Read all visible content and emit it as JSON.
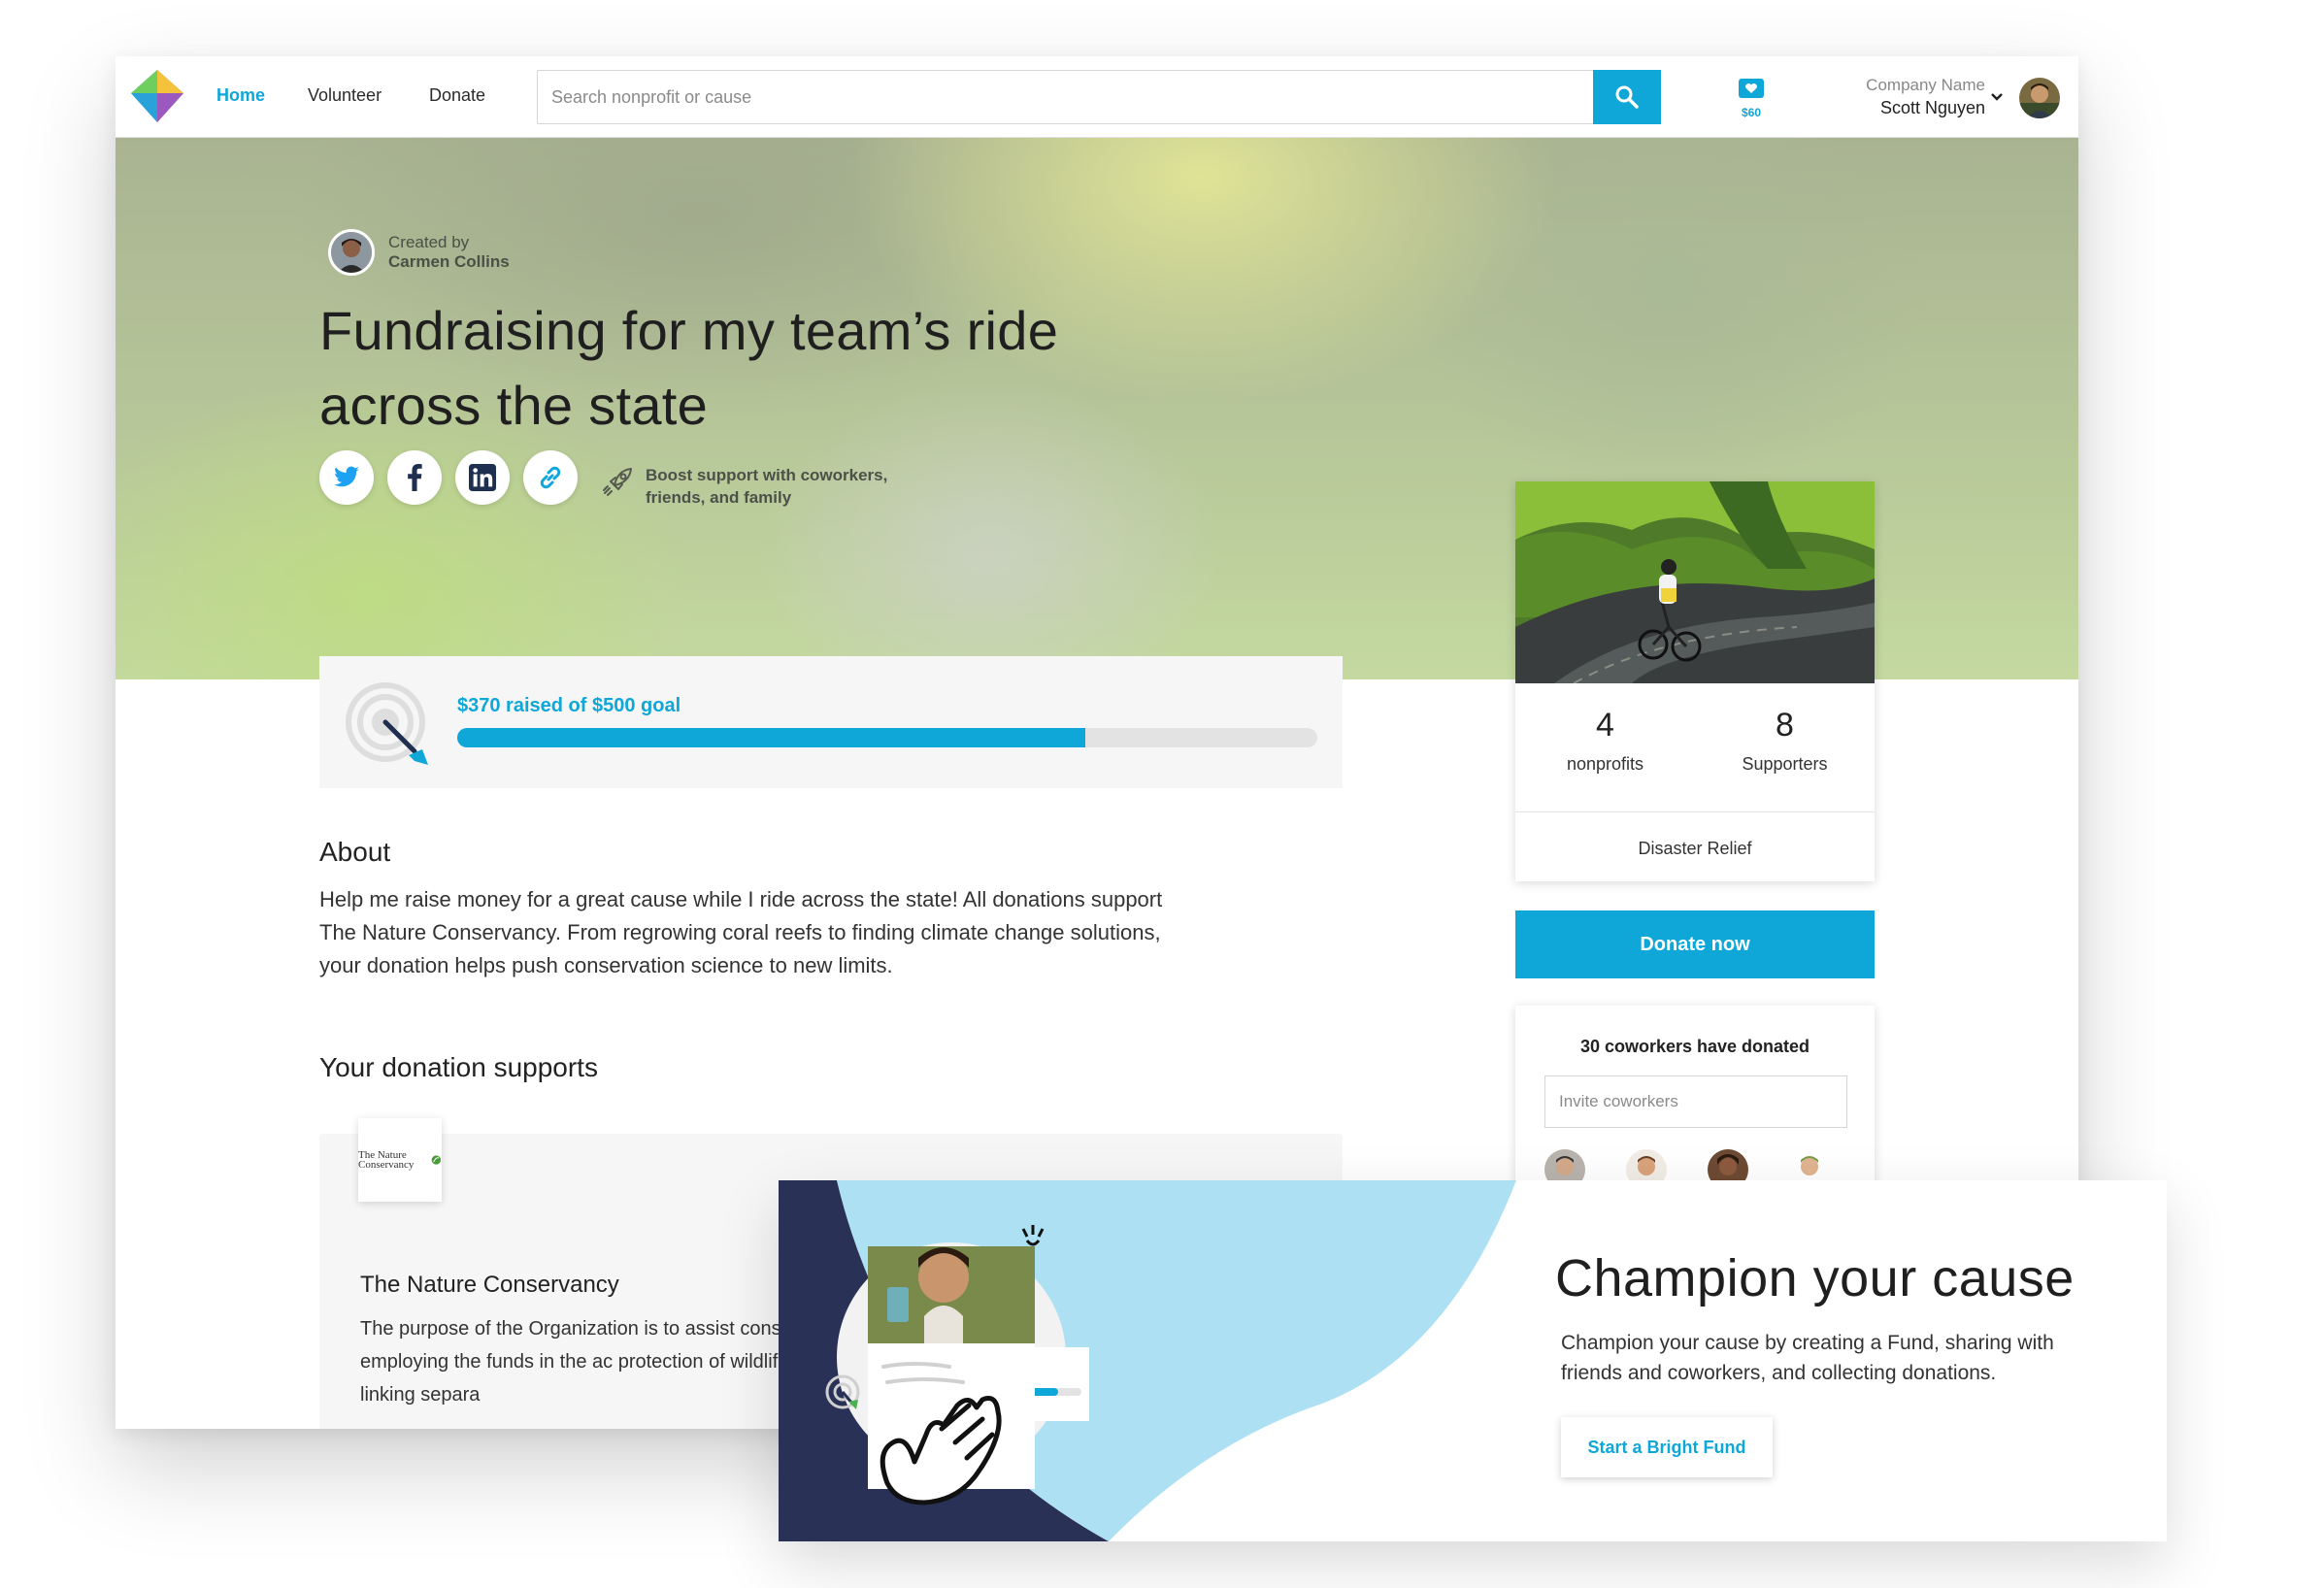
{
  "nav": {
    "links": [
      "Home",
      "Volunteer",
      "Donate"
    ],
    "search_placeholder": "Search nonprofit or cause",
    "wallet_amount": "$60",
    "company": "Company Name",
    "user": "Scott Nguyen"
  },
  "hero": {
    "created_by_label": "Created by",
    "creator_name": "Carmen Collins",
    "title": "Fundraising for my team’s ride across the state",
    "boost_text": "Boost support with coworkers, friends, and family",
    "social_icons": [
      "twitter-icon",
      "facebook-icon",
      "linkedin-icon",
      "link-icon"
    ]
  },
  "progress": {
    "text": "$370 raised of $500 goal",
    "raised": 370,
    "goal": 500,
    "fraction": 0.73
  },
  "about": {
    "heading": "About",
    "text": "Help me raise money for a great cause while I ride across the state! All donations support The Nature Conservancy. From regrowing coral reefs to finding climate change solutions, your donation helps push conservation science to new limits."
  },
  "supports": {
    "heading": "Your donation supports",
    "nonprofit_name": "The Nature Conservancy",
    "logo_text": "The Nature Conservancy",
    "description": "The purpose of the Organization is to assist conservation goals in California This involves agencies and employing the funds in the ac protection of wildlife and habitat that (1) pro species, (2) provides corridors linking separa"
  },
  "fund": {
    "nonprofits_count": "4",
    "nonprofits_label": "nonprofits",
    "supporters_count": "8",
    "supporters_label": "Supporters",
    "cause": "Disaster Relief",
    "donate_label": "Donate now",
    "coworkers_title": "30 coworkers have donated",
    "invite_placeholder": "Invite coworkers"
  },
  "promo": {
    "title": "Champion your cause",
    "description": "Champion your cause by creating a Fund, sharing with friends and coworkers, and collecting donations.",
    "button_label": "Start a Bright Fund"
  },
  "colors": {
    "accent": "#0fa6d8",
    "navy": "#2a3156",
    "light_blue": "#aee0f3"
  }
}
